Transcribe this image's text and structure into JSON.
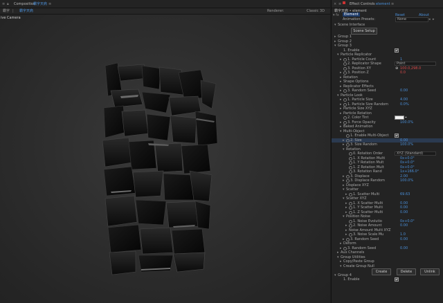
{
  "composition": {
    "panel_title": "Composition",
    "comp_name": "霸字天肩",
    "tab_label": "霸字天肩",
    "crumb": "霸字",
    "renderer_label": "Renderer:",
    "renderer_value": "Classic 3D",
    "camera_label": "ive Camera"
  },
  "effect_controls": {
    "panel_title": "Effect Controls",
    "layer_name": "element",
    "breadcrumb": "霸字天肩 • element",
    "effect_name": "Element",
    "reset_label": "Reset",
    "about_label": "About",
    "animation_presets_label": "Animation Presets:",
    "animation_presets_value": "None",
    "rows": [
      {
        "label": "Scene Interface",
        "indent": 1,
        "arrow": "down"
      },
      {
        "label": "Scene Setup",
        "button": true
      },
      {
        "label": "Group 1",
        "indent": 1,
        "arrow": "right"
      },
      {
        "label": "Group 2",
        "indent": 1,
        "arrow": "right"
      },
      {
        "label": "Group 3",
        "indent": 1,
        "arrow": "down"
      },
      {
        "label": "1. Enable",
        "indent": 3,
        "checkbox": true
      },
      {
        "label": "Particle Replicator",
        "indent": 2,
        "arrow": "down"
      },
      {
        "label": "1. Particle Count",
        "indent": 3,
        "arrow": "right",
        "watch": true,
        "value": "1"
      },
      {
        "label": "2. Replicator Shape",
        "indent": 3,
        "watch": true,
        "dropdown": "Point"
      },
      {
        "label": "3. Position XY",
        "indent": 3,
        "watch": true,
        "value": "100.0,298.0",
        "red": true,
        "crosshair": true
      },
      {
        "label": "3. Position Z",
        "indent": 3,
        "arrow": "right",
        "watch": true,
        "value": "0.0",
        "red": true
      },
      {
        "label": "Rotation",
        "indent": 3,
        "arrow": "right"
      },
      {
        "label": "Shape Options",
        "indent": 3,
        "arrow": "right"
      },
      {
        "label": "Replicator Effects",
        "indent": 3,
        "arrow": "right"
      },
      {
        "label": "3. Random Seed",
        "indent": 3,
        "arrow": "right",
        "watch": true,
        "value": "0.00"
      },
      {
        "label": "Particle Look",
        "indent": 2,
        "arrow": "down"
      },
      {
        "label": "1. Particle Size",
        "indent": 3,
        "arrow": "right",
        "watch": true,
        "value": "4.00"
      },
      {
        "label": "1. Particle Size Random",
        "indent": 3,
        "arrow": "right",
        "watch": true,
        "value": "0.0%"
      },
      {
        "label": "Particle Size XYZ",
        "indent": 3,
        "arrow": "right"
      },
      {
        "label": "Particle Rotation",
        "indent": 3,
        "arrow": "right"
      },
      {
        "label": "2. Color Tint",
        "indent": 3,
        "watch": true,
        "swatch": true
      },
      {
        "label": "3. Force Opacity",
        "indent": 3,
        "arrow": "right",
        "watch": true,
        "value": "100.0%"
      },
      {
        "label": "Baked Animation",
        "indent": 3,
        "arrow": "right"
      },
      {
        "label": "Multi-Object",
        "indent": 3,
        "arrow": "down"
      },
      {
        "label": "1. Enable Multi-Object",
        "indent": 4,
        "watch": true,
        "checkbox": true
      },
      {
        "label": "2. Size",
        "indent": 4,
        "arrow": "right",
        "watch": true,
        "value": "0.00",
        "highlight": true
      },
      {
        "label": "3. Size Random",
        "indent": 4,
        "arrow": "right",
        "watch": true,
        "value": "100.0%"
      },
      {
        "label": "Rotation",
        "indent": 4,
        "arrow": "down"
      },
      {
        "label": "0. Rotation Order",
        "indent": 5,
        "watch": true,
        "dropdown": "XYZ (Standard)"
      },
      {
        "label": "1. X Rotation Multi",
        "indent": 5,
        "watch": true,
        "value": "0x+0.0°"
      },
      {
        "label": "1. Y Rotation Mult",
        "indent": 5,
        "watch": true,
        "value": "0x+0.0°"
      },
      {
        "label": "1. Z Rotation Mult",
        "indent": 5,
        "watch": true,
        "value": "0x+0.0°"
      },
      {
        "label": "3. Rotation Rand",
        "indent": 5,
        "watch": true,
        "value": "1x+166.0°"
      },
      {
        "label": "3. Displace",
        "indent": 4,
        "arrow": "right",
        "watch": true,
        "value": "2.00"
      },
      {
        "label": "3. Displace Random",
        "indent": 4,
        "arrow": "right",
        "watch": true,
        "value": "100.0%"
      },
      {
        "label": "Displace XYZ",
        "indent": 4,
        "arrow": "right"
      },
      {
        "label": "Scatter",
        "indent": 4,
        "arrow": "down"
      },
      {
        "label": "1. Scatter Multi",
        "indent": 5,
        "arrow": "right",
        "watch": true,
        "value": "69.63"
      },
      {
        "label": "Scatter XYZ",
        "indent": 4,
        "arrow": "down"
      },
      {
        "label": "1. X Scatter Multi",
        "indent": 5,
        "arrow": "right",
        "watch": true,
        "value": "0.00"
      },
      {
        "label": "1. Y Scatter Multi",
        "indent": 5,
        "arrow": "right",
        "watch": true,
        "value": "0.00"
      },
      {
        "label": "1. Z Scatter Multi",
        "indent": 5,
        "arrow": "right",
        "watch": true,
        "value": "0.00"
      },
      {
        "label": "Position Noise",
        "indent": 4,
        "arrow": "down"
      },
      {
        "label": "1. Noise Evolutio",
        "indent": 5,
        "watch": true,
        "value": "0x+0.0°"
      },
      {
        "label": "2. Noise Amount",
        "indent": 5,
        "arrow": "right",
        "watch": true,
        "value": "0.00"
      },
      {
        "label": "Noise Amount Multi XYZ",
        "indent": 5,
        "arrow": "right"
      },
      {
        "label": "3. Noise Scale Mu",
        "indent": 5,
        "arrow": "right",
        "watch": true,
        "value": "1.0"
      },
      {
        "label": "3. Random Seed",
        "indent": 4,
        "arrow": "right",
        "watch": true,
        "value": "0.00"
      },
      {
        "label": "Deform",
        "indent": 3,
        "arrow": "right"
      },
      {
        "label": "3. Random Seed",
        "indent": 3,
        "arrow": "right",
        "watch": true,
        "value": "0.00"
      },
      {
        "label": "Aux Channels",
        "indent": 2,
        "arrow": "right"
      },
      {
        "label": "Group Utilities",
        "indent": 2,
        "arrow": "down"
      },
      {
        "label": "Copy/Paste Group",
        "indent": 3,
        "arrow": "right"
      },
      {
        "label": "Create Group Null",
        "indent": 3,
        "arrow": "down"
      },
      {
        "label": "buttons",
        "buttons": [
          "Create",
          "Delete",
          "Unlink"
        ]
      },
      {
        "label": "Group 4",
        "indent": 1,
        "arrow": "down"
      },
      {
        "label": "1. Enable",
        "indent": 3,
        "checkbox": true
      }
    ]
  },
  "colors": {
    "accent": "#4a8fd8",
    "error": "#d84a4a"
  }
}
